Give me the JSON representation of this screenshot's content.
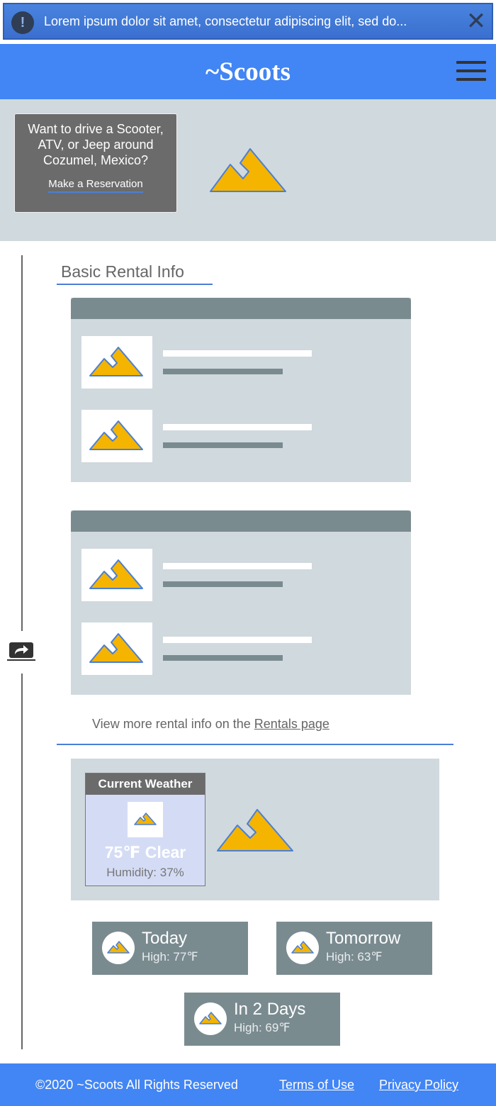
{
  "notice": {
    "text": "Lorem ipsum dolor sit amet, consectetur adipiscing elit, sed do...",
    "icon": "!",
    "close_icon": "✕"
  },
  "header": {
    "brand": "~Scoots"
  },
  "hero": {
    "text": "Want to drive a Scooter, ATV, or Jeep around Cozumel, Mexico?",
    "link": "Make a Reservation"
  },
  "rental": {
    "title": "Basic Rental Info",
    "more_prefix": "View more rental info on the ",
    "more_link": "Rentals page"
  },
  "weather": {
    "heading": "Current Weather",
    "temp": "75℉ Clear",
    "humidity": "Humidity: 37%",
    "forecast": [
      {
        "day": "Today",
        "high": "High: 77℉"
      },
      {
        "day": "Tomorrow",
        "high": "High: 63℉"
      },
      {
        "day": "In 2 Days",
        "high": "High: 69℉"
      }
    ]
  },
  "footer": {
    "copyright": "©2020 ~Scoots  All Rights Reserved",
    "terms": "Terms of Use",
    "privacy": "Privacy Policy"
  },
  "colors": {
    "header_blue": "#4285f4",
    "panel_gray": "#d0d9dd",
    "slate": "#7a8b90",
    "mountain_fill": "#f4b400",
    "mountain_stroke": "#4a7fd8"
  }
}
